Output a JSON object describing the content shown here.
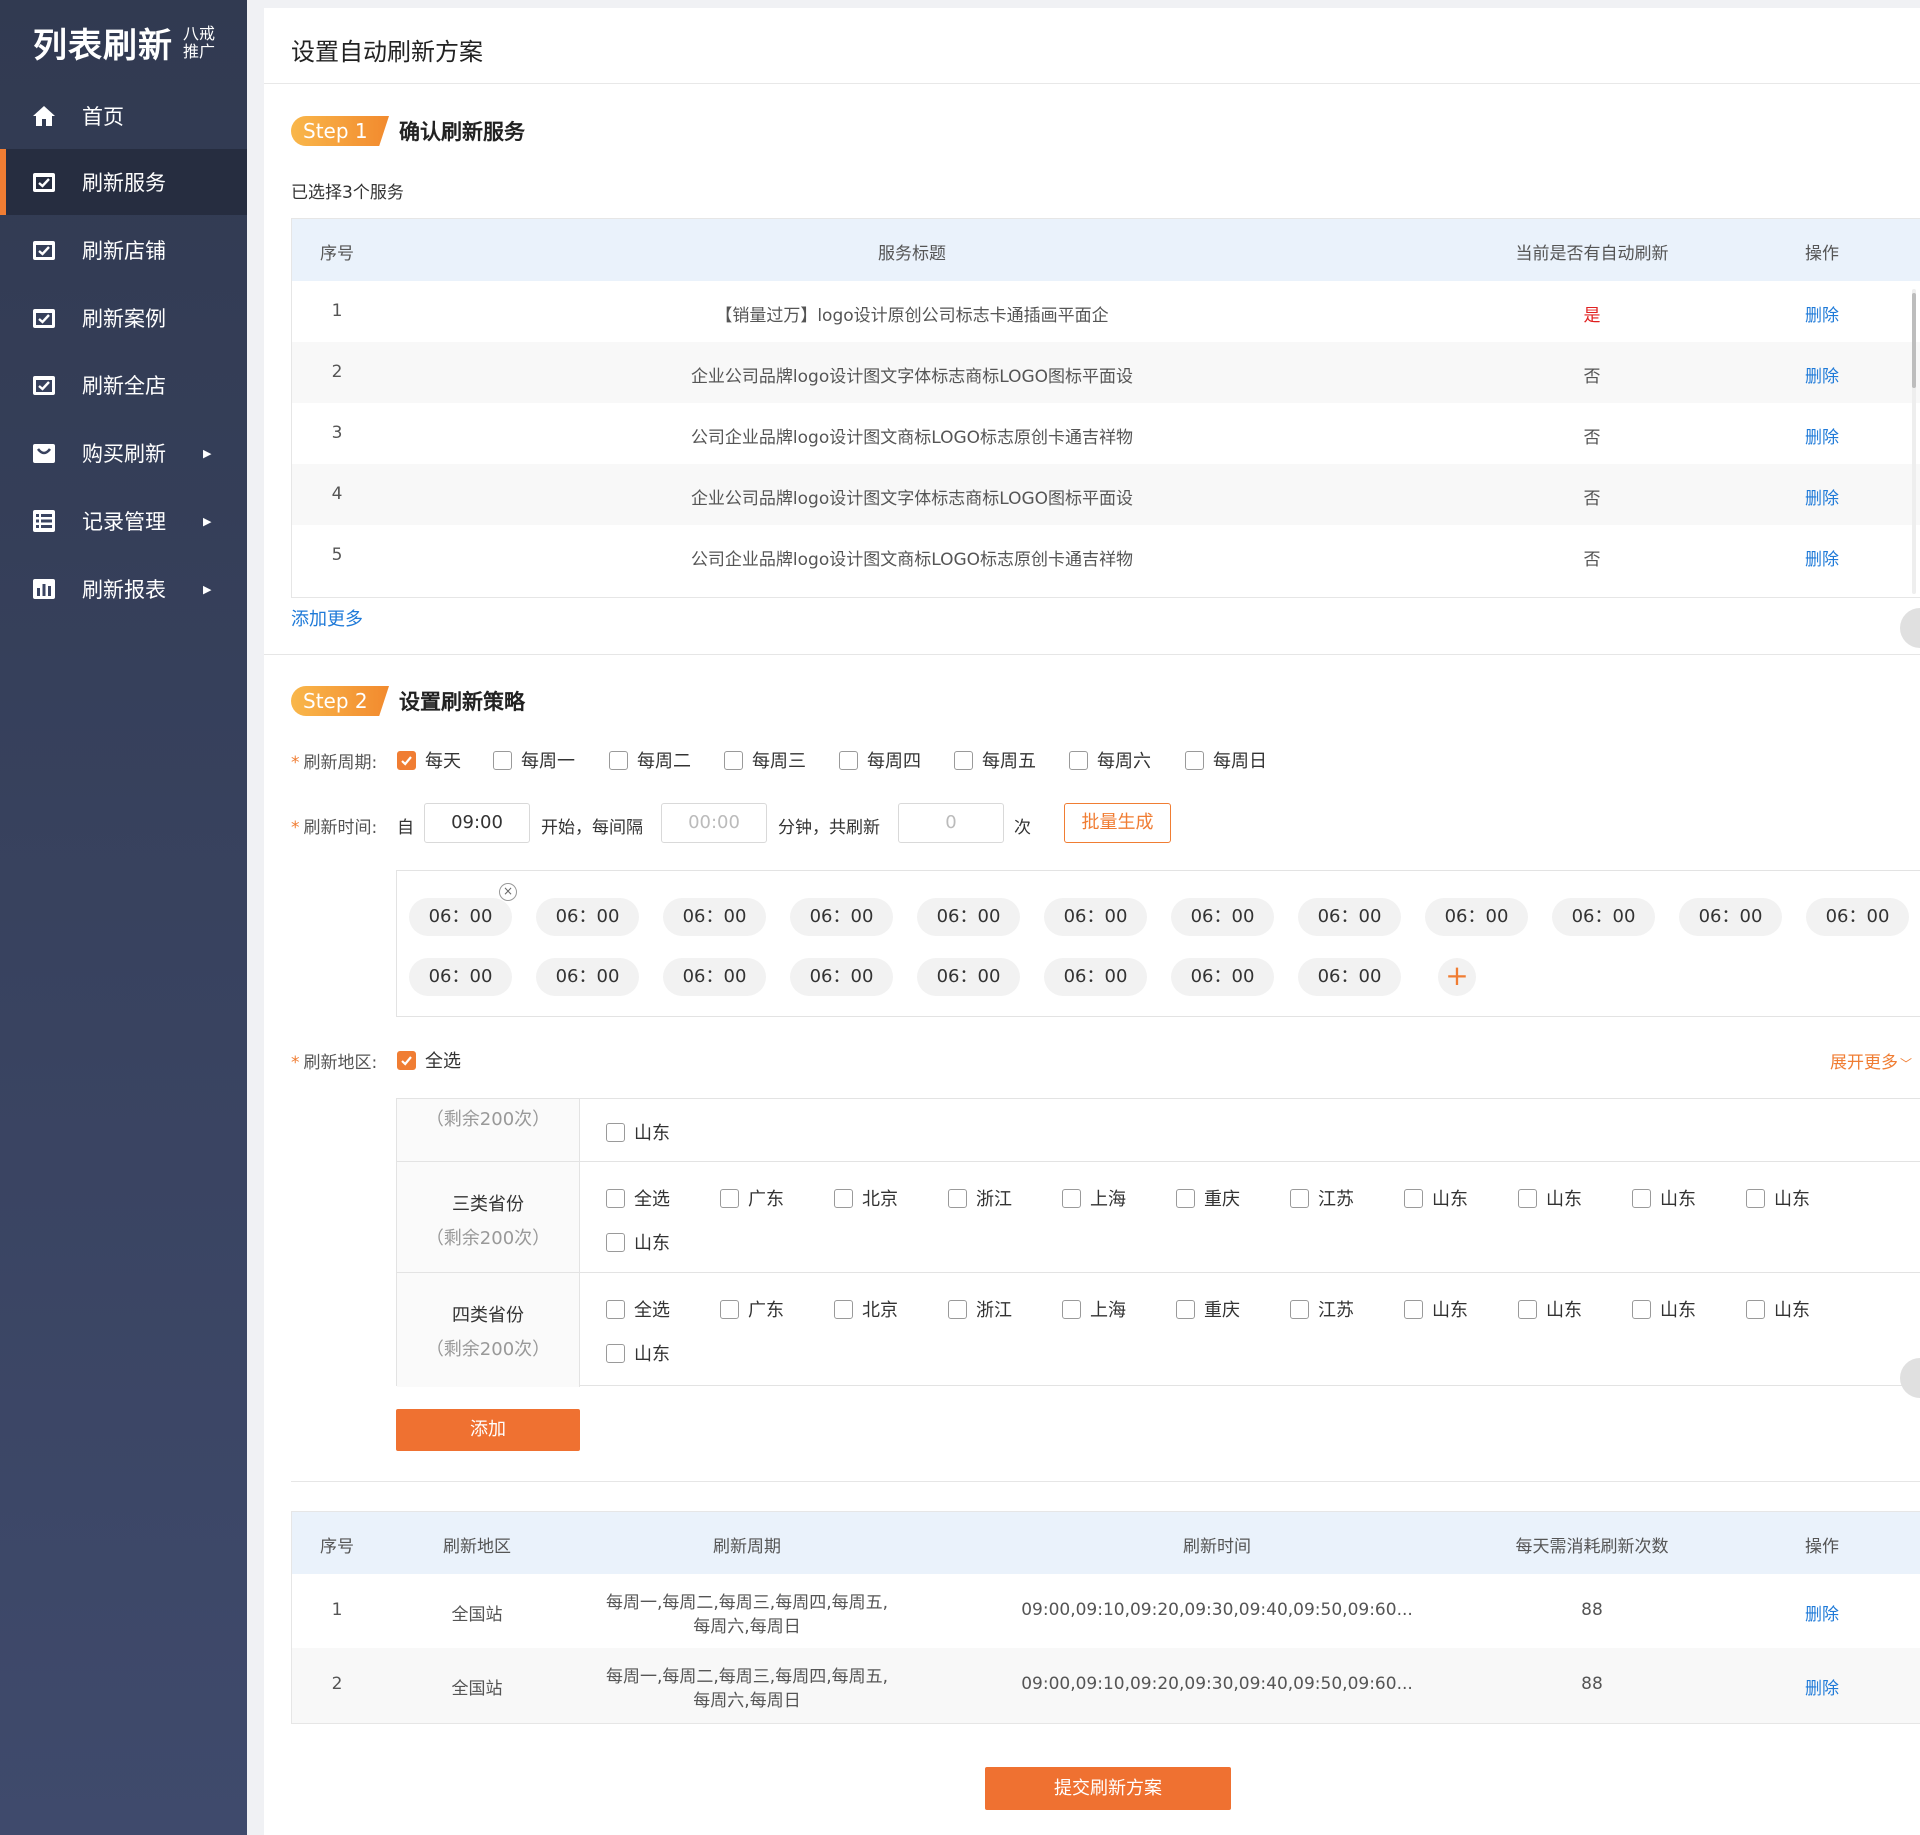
{
  "sidebar": {
    "logo_main": "列表刷新",
    "logo_sub": "八戒推广",
    "items": [
      {
        "label": "首页",
        "icon": "home-icon"
      },
      {
        "label": "刷新服务",
        "icon": "check-square-icon"
      },
      {
        "label": "刷新店铺",
        "icon": "check-square-icon"
      },
      {
        "label": "刷新案例",
        "icon": "check-square-icon"
      },
      {
        "label": "刷新全店",
        "icon": "check-square-icon"
      },
      {
        "label": "购买刷新",
        "icon": "bag-icon"
      },
      {
        "label": "记录管理",
        "icon": "list-icon"
      },
      {
        "label": "刷新报表",
        "icon": "bar-chart-icon"
      }
    ],
    "active_index": 1
  },
  "page": {
    "title": "设置自动刷新方案"
  },
  "step1": {
    "badge": "Step 1",
    "title": "确认刷新服务",
    "selected_text": "已选择3个服务",
    "headers": [
      "序号",
      "服务标题",
      "当前是否有自动刷新",
      "操作"
    ],
    "rows": [
      {
        "no": "1",
        "title": "【销量过万】logo设计原创公司标志卡通插画平面企",
        "auto": "是",
        "op": "删除"
      },
      {
        "no": "2",
        "title": "企业公司品牌logo设计图文字体标志商标LOGO图标平面设",
        "auto": "否",
        "op": "删除"
      },
      {
        "no": "3",
        "title": "公司企业品牌logo设计图文商标LOGO标志原创卡通吉祥物",
        "auto": "否",
        "op": "删除"
      },
      {
        "no": "4",
        "title": "企业公司品牌logo设计图文字体标志商标LOGO图标平面设",
        "auto": "否",
        "op": "删除"
      },
      {
        "no": "5",
        "title": "公司企业品牌logo设计图文商标LOGO标志原创卡通吉祥物",
        "auto": "否",
        "op": "删除"
      }
    ],
    "add_more": "添加更多"
  },
  "step2": {
    "badge": "Step 2",
    "title": "设置刷新策略",
    "cycle_label": "刷新周期:",
    "cycle_options": [
      {
        "label": "每天",
        "checked": true
      },
      {
        "label": "每周一",
        "checked": false
      },
      {
        "label": "每周二",
        "checked": false
      },
      {
        "label": "每周三",
        "checked": false
      },
      {
        "label": "每周四",
        "checked": false
      },
      {
        "label": "每周五",
        "checked": false
      },
      {
        "label": "每周六",
        "checked": false
      },
      {
        "label": "每周日",
        "checked": false
      }
    ],
    "time_label": "刷新时间:",
    "time_from": "自",
    "time_start_value": "09:00",
    "time_start_text": "开始，每间隔",
    "interval_placeholder": "00:00",
    "interval_unit": "分钟，共刷新",
    "count_placeholder": "0",
    "count_unit": "次",
    "batch_button": "批量生成",
    "time_chips": [
      "06：00",
      "06：00",
      "06：00",
      "06：00",
      "06：00",
      "06：00",
      "06：00",
      "06：00",
      "06：00",
      "06：00",
      "06：00",
      "06：00",
      "06：00",
      "06：00",
      "06：00",
      "06：00",
      "06：00",
      "06：00",
      "06：00",
      "06：00"
    ],
    "region_label": "刷新地区:",
    "region_select_all": "全选",
    "expand_more": "展开更多",
    "partial_group": {
      "sub": "（剩余200次）",
      "items": [
        "山东"
      ]
    },
    "groups": [
      {
        "name": "三类省份",
        "sub": "（剩余200次）",
        "items": [
          "全选",
          "广东",
          "北京",
          "浙江",
          "上海",
          "重庆",
          "江苏",
          "山东",
          "山东",
          "山东",
          "山东",
          "山东"
        ]
      },
      {
        "name": "四类省份",
        "sub": "（剩余200次）",
        "items": [
          "全选",
          "广东",
          "北京",
          "浙江",
          "上海",
          "重庆",
          "江苏",
          "山东",
          "山东",
          "山东",
          "山东",
          "山东"
        ]
      }
    ],
    "add_button": "添加"
  },
  "plan_table": {
    "headers": [
      "序号",
      "刷新地区",
      "刷新周期",
      "刷新时间",
      "每天需消耗刷新次数",
      "操作"
    ],
    "rows": [
      {
        "no": "1",
        "region": "全国站",
        "cycle_l1": "每周一,每周二,每周三,每周四,每周五,",
        "cycle_l2": "每周六,每周日",
        "times": "09:00,09:10,09:20,09:30,09:40,09:50,09:60...",
        "count": "88",
        "op": "删除"
      },
      {
        "no": "2",
        "region": "全国站",
        "cycle_l1": "每周一,每周二,每周三,每周四,每周五,",
        "cycle_l2": "每周六,每周日",
        "times": "09:00,09:10,09:20,09:30,09:40,09:50,09:60...",
        "count": "88",
        "op": "删除"
      }
    ]
  },
  "submit_button": "提交刷新方案",
  "colors": {
    "accent": "#ef7131",
    "link": "#1f7ad8",
    "sidebar": "#353f5a",
    "yes": "#e02020"
  }
}
